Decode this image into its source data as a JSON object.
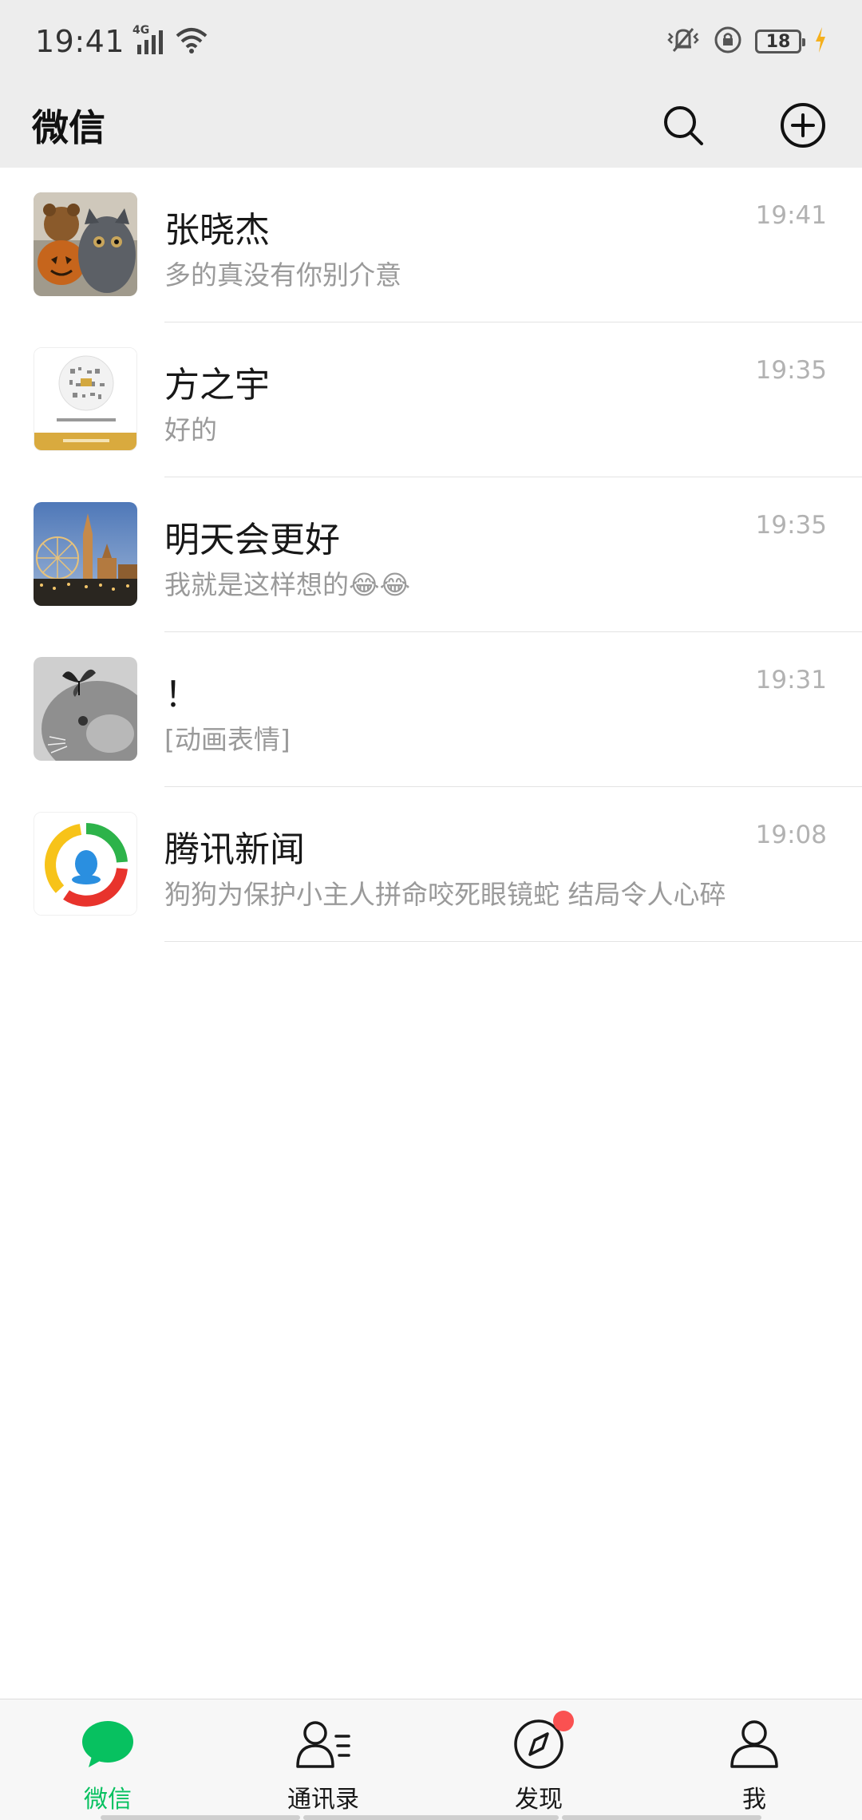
{
  "status_bar": {
    "time": "19:41",
    "network": "4G",
    "battery": "18",
    "icons": [
      "signal-icon",
      "wifi-icon",
      "vibrate-icon",
      "rotation-lock-icon",
      "battery-icon",
      "charging-icon"
    ]
  },
  "header": {
    "title": "微信",
    "icons": [
      "search-icon",
      "add-icon"
    ]
  },
  "chats": [
    {
      "name": "张晓杰",
      "preview": "多的真没有你别介意",
      "time": "19:41",
      "avatar": "cat-and-bear-photo"
    },
    {
      "name": "方之宇",
      "preview": "好的",
      "time": "19:35",
      "avatar": "qr-code-card"
    },
    {
      "name": "明天会更好",
      "preview": "我就是这样想的😂😂",
      "time": "19:35",
      "avatar": "city-night-photo"
    },
    {
      "name": "！",
      "preview": "[动画表情]",
      "time": "19:31",
      "avatar": "cat-butterfly-photo"
    },
    {
      "name": "腾讯新闻",
      "preview": "狗狗为保护小主人拼命咬死眼镜蛇 结局令人心碎",
      "time": "19:08",
      "avatar": "tencent-news-logo"
    }
  ],
  "tabs": [
    {
      "label": "微信",
      "icon": "chat-bubble-icon",
      "active": true
    },
    {
      "label": "通讯录",
      "icon": "contacts-icon",
      "active": false
    },
    {
      "label": "发现",
      "icon": "compass-icon",
      "active": false,
      "badge": "red-dot"
    },
    {
      "label": "我",
      "icon": "person-icon",
      "active": false
    }
  ],
  "colors": {
    "accent": "#07c160",
    "header_bg": "#ededed",
    "badge": "#fa5151"
  }
}
